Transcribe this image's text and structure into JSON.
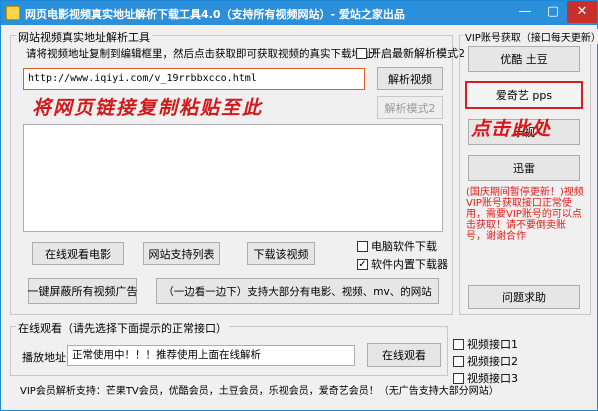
{
  "window": {
    "title": "网页电影视频真实地址解析下载工具4.0（支持所有视频网站）- 爱站之家出品",
    "min_glyph": "—",
    "max_glyph": "▢",
    "close_glyph": "✕"
  },
  "parse_section": {
    "group_title": "网站视频真实地址解析工具",
    "instruction": "请将视频地址复制到编辑框里，然后点击获取即可获取视频的真实下载地址！",
    "new_mode_checkbox": {
      "label": "开启最新解析模式2",
      "checked": false
    },
    "url_input": {
      "value": "http://www.iqiyi.com/v_19rrbbxcco.html"
    },
    "parse_button": "解析视频",
    "parse_mode2_button": "解析模式2",
    "paste_hint": "将网页链接复制粘贴至此",
    "buttons": {
      "watch_online": "在线观看电影",
      "supported_sites": "网站支持列表",
      "download_video": "下载该视频",
      "block_ads": "一键屏蔽所有视频广告",
      "dual_play": "（一边看一边下）支持大部分有电影、视频、mv、的网站"
    },
    "pc_download_checkbox": {
      "label": "电脑软件下载",
      "checked": false
    },
    "builtin_downloader_checkbox": {
      "label": "软件内置下载器",
      "checked": true
    }
  },
  "vip_section": {
    "group_title": "VIP账号获取（接口每天更新）",
    "youku_button": "优酷 土豆",
    "iqiyi_button": "爱奇艺 pps",
    "letv_button": "乐视",
    "xunlei_button": "迅雷",
    "click_hint": "点击此处",
    "notice": "(国庆期间暂停更新！)视频VIP账号获取接口正常使用，需要VIP账号的可以点击获取！请不要倒卖账号，谢谢合作",
    "help_button": "问题求助"
  },
  "online_section": {
    "group_title": "在线观看（请先选择下面提示的正常接口）",
    "address_label": "播放地址:",
    "address_value": "正常使用中！！！推荐使用上面在线解析",
    "watch_button": "在线观看",
    "interfaces": [
      {
        "label": "视频接口1",
        "checked": false
      },
      {
        "label": "视频接口2",
        "checked": false
      },
      {
        "label": "视频接口3",
        "checked": false
      }
    ],
    "footer": "VIP会员解析支持：芒果TV会员，优酷会员，土豆会员，乐视会员，爱奇艺会员！（无广告支持大部分网站）"
  }
}
